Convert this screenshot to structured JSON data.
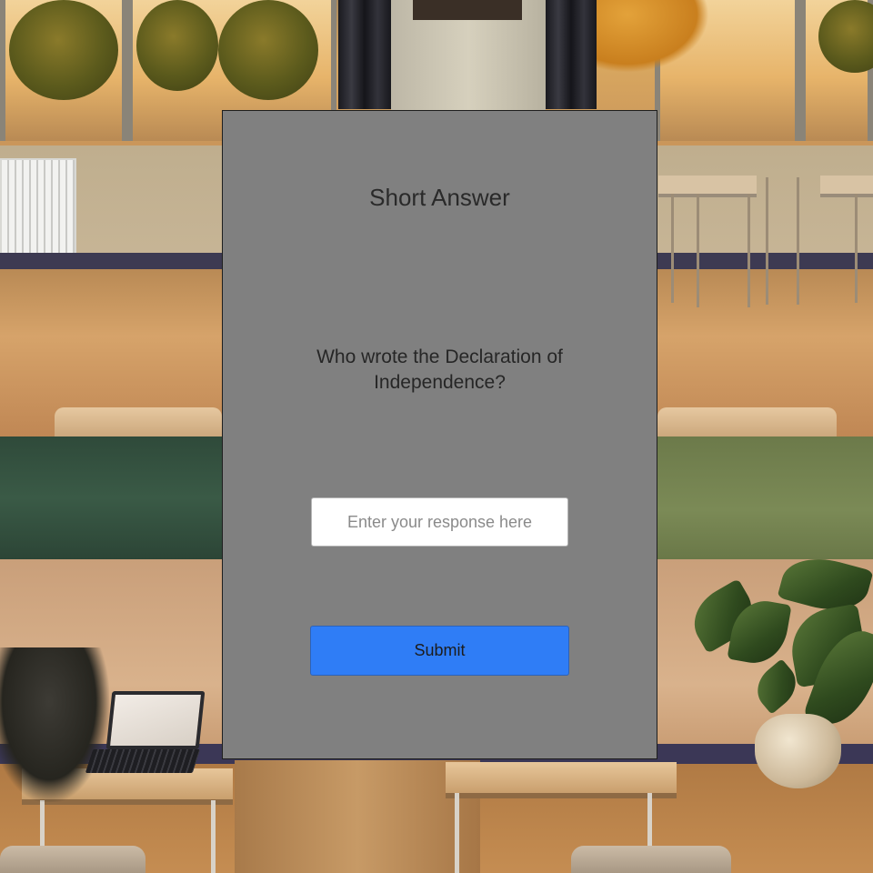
{
  "panel": {
    "title": "Short Answer",
    "question": "Who wrote the Declaration of Independence?",
    "response_input": {
      "value": "",
      "placeholder": "Enter your response here"
    },
    "submit_label": "Submit"
  },
  "colors": {
    "panel_background": "#808080",
    "submit_button": "#2f7df6",
    "input_background": "#ffffff"
  }
}
